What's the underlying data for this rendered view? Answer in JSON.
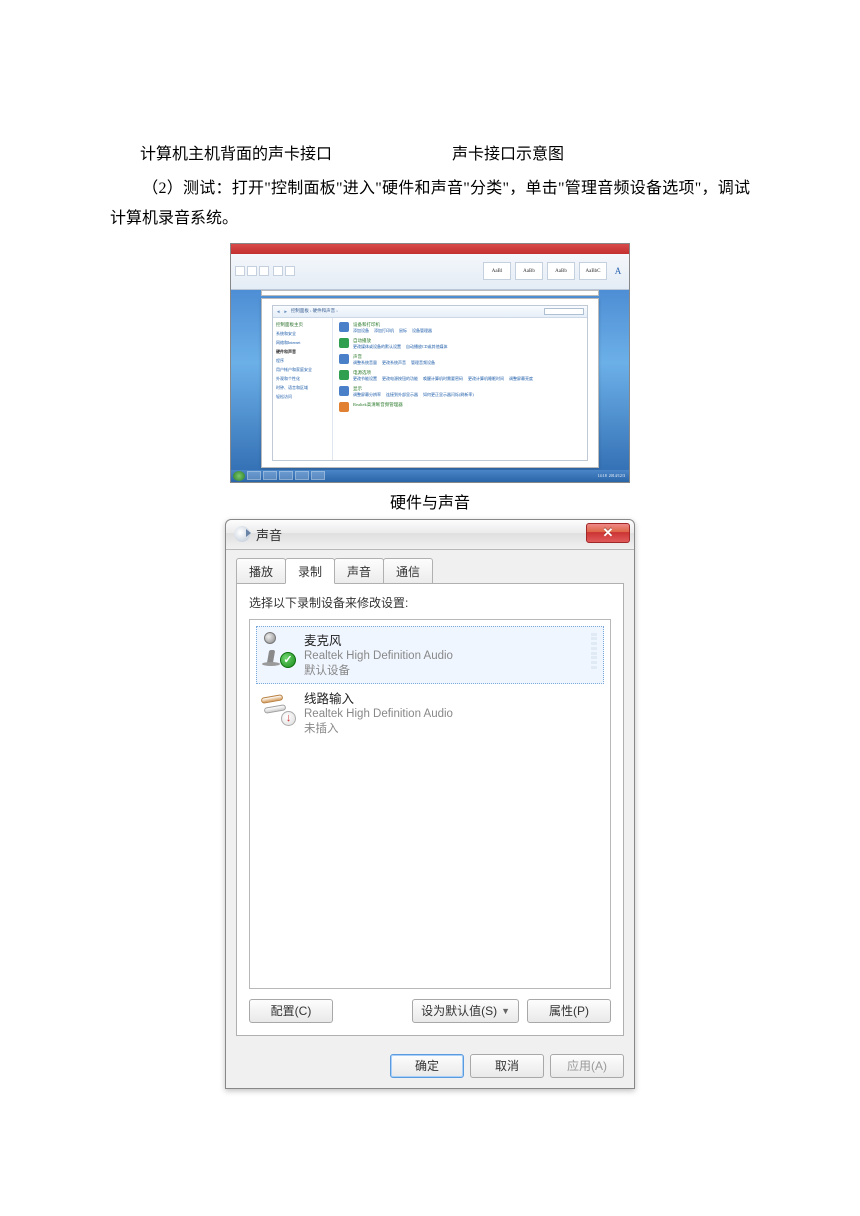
{
  "text": {
    "line1a": "计算机主机背面的声卡接口",
    "line1b": "声卡接口示意图",
    "para2": "（2）测试：打开\"控制面板\"进入\"硬件和声音\"分类\"，单击\"管理音频设备选项\"，调试计算机录音系统。",
    "caption_hw": "硬件与声音"
  },
  "word_ribbon": {
    "styles": [
      "AaBl",
      "AaBb",
      "AaBb",
      "AaBbC"
    ],
    "find_icon": "A"
  },
  "control_panel": {
    "breadcrumb": "控制面板 › 硬件和声音 ›",
    "home": "控制面板主页",
    "side": [
      "系统和安全",
      "网络和Internet",
      "硬件和声音",
      "程序",
      "用户帐户和家庭安全",
      "外观和个性化",
      "时钟、语言和区域",
      "轻松访问"
    ],
    "cats": [
      {
        "title": "设备和打印机",
        "links": [
          "添加设备",
          "添加打印机",
          "鼠标",
          "设备管理器"
        ]
      },
      {
        "title": "自动播放",
        "links": [
          "更改媒体或设备的默认设置",
          "自动播放CD或其他媒体"
        ]
      },
      {
        "title": "声音",
        "links": [
          "调整系统音量",
          "更改系统声音",
          "管理音频设备"
        ]
      },
      {
        "title": "电源选项",
        "links": [
          "更改节能设置",
          "更改电源按钮的功能",
          "唤醒计算机时需要密码",
          "更改计算机睡眠时间",
          "调整屏幕亮度"
        ]
      },
      {
        "title": "显示",
        "links": [
          "调整屏幕分辨率",
          "连接到外部显示器",
          "如何更正显示器闪烁(刷新率)"
        ]
      },
      {
        "title": "Realtek高清晰音频管理器",
        "links": []
      }
    ]
  },
  "taskbar": {
    "time": "14:18",
    "date": "2014/12/3"
  },
  "sound_dialog": {
    "title": "声音",
    "tabs": [
      "播放",
      "录制",
      "声音",
      "通信"
    ],
    "active_tab": 1,
    "instruction": "选择以下录制设备来修改设置:",
    "devices": [
      {
        "name": "麦克风",
        "sub1": "Realtek High Definition Audio",
        "sub2": "默认设备",
        "selected": true,
        "status": "ok"
      },
      {
        "name": "线路输入",
        "sub1": "Realtek High Definition Audio",
        "sub2": "未插入",
        "selected": false,
        "status": "unplugged"
      }
    ],
    "btn_configure": "配置(C)",
    "btn_default": "设为默认值(S)",
    "btn_properties": "属性(P)",
    "btn_ok": "确定",
    "btn_cancel": "取消",
    "btn_apply": "应用(A)"
  }
}
